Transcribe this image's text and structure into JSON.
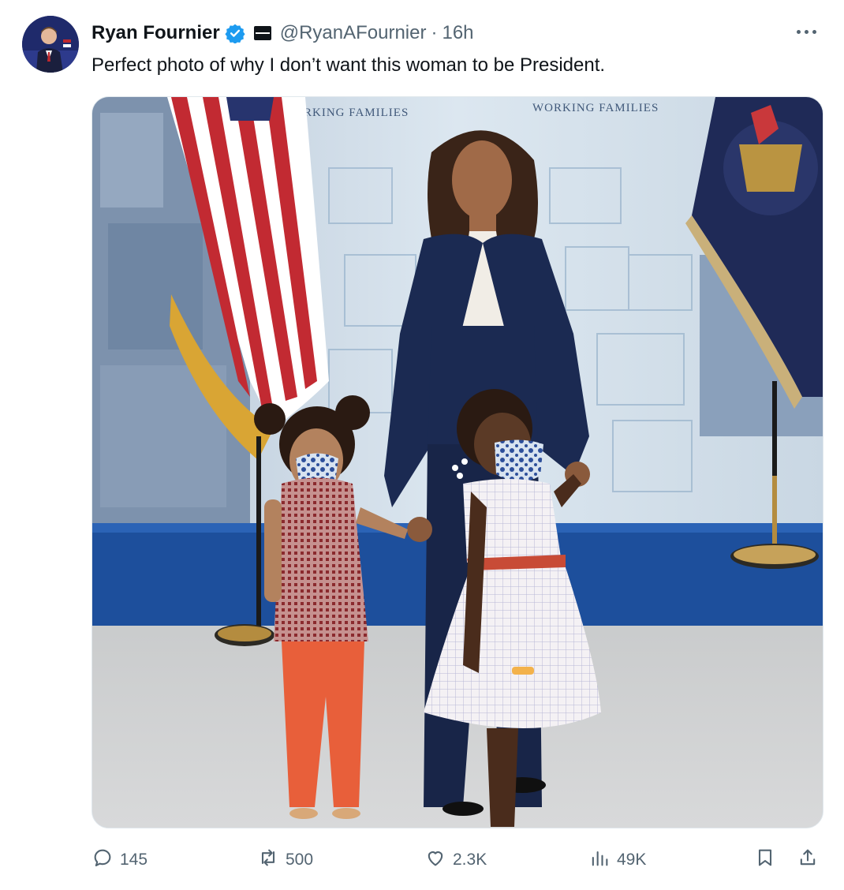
{
  "author": {
    "name": "Ryan Fournier",
    "handle": "@RyanAFournier",
    "separator": "·",
    "time": "16h",
    "verified": true
  },
  "tweet": {
    "text": "Perfect photo of why I don’t want this woman to be President.",
    "photo": {
      "banner_text_left": "RKING FAMILIES",
      "banner_text_right": "WORKING FAMILIES"
    }
  },
  "actions": {
    "replies": "145",
    "reposts": "500",
    "likes": "2.3K",
    "views": "49K"
  },
  "colors": {
    "name_text": "#0f1419",
    "secondary_text": "#536471",
    "verified_blue": "#1d9bf0"
  },
  "icons": [
    "more-icon",
    "verified-icon",
    "flag-badge-icon",
    "reply-icon",
    "repost-icon",
    "like-icon",
    "views-icon",
    "bookmark-icon",
    "share-icon"
  ]
}
